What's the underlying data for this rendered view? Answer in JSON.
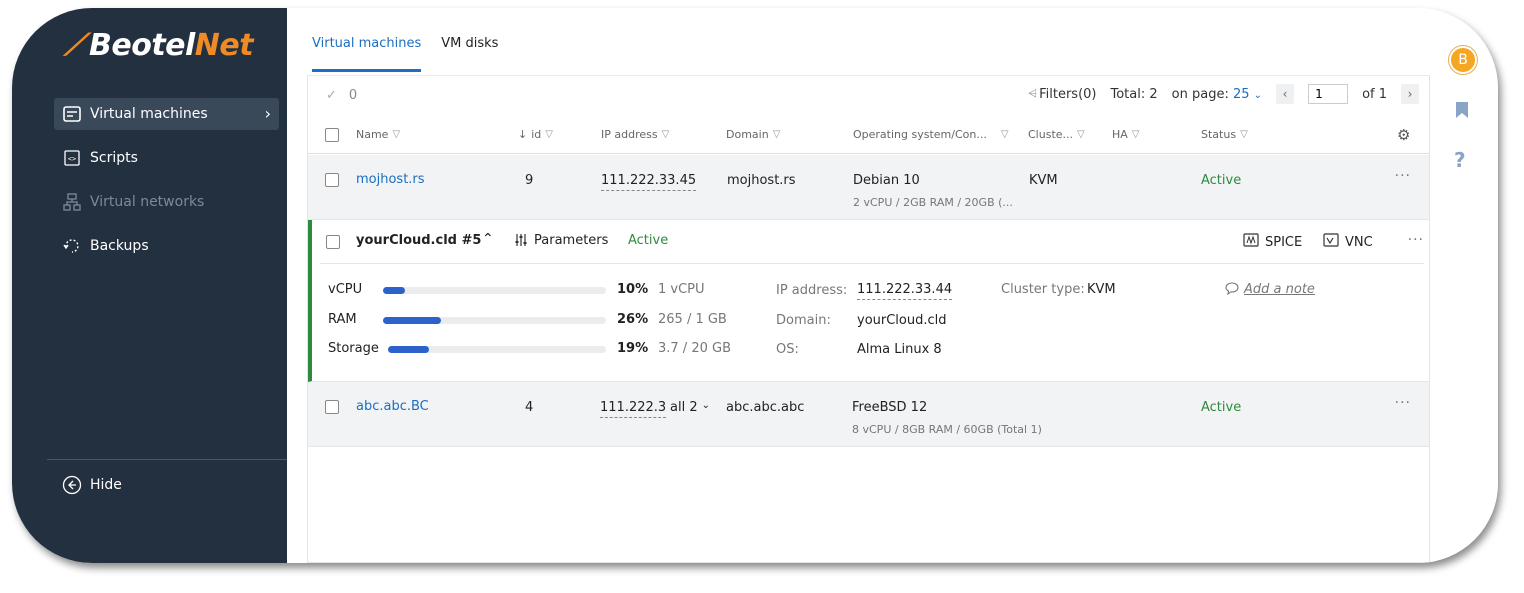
{
  "brand": {
    "name_white": "Beotel",
    "name_orange": "Net"
  },
  "sidebar": {
    "items": [
      {
        "label": "Virtual machines",
        "icon": "vm-icon",
        "active": true
      },
      {
        "label": "Scripts",
        "icon": "script-icon"
      },
      {
        "label": "Virtual networks",
        "icon": "network-icon",
        "disabled": true
      },
      {
        "label": "Backups",
        "icon": "backup-icon"
      }
    ],
    "hide_label": "Hide"
  },
  "tabs": [
    {
      "label": "Virtual machines",
      "active": true
    },
    {
      "label": "VM disks"
    }
  ],
  "toolbar": {
    "selected_count": "0",
    "filters_label": "Filters(0)",
    "total_label": "Total: 2",
    "on_page_label": "on page:",
    "on_page_value": "25",
    "page_value": "1",
    "of_label": "of 1"
  },
  "columns": {
    "name": "Name",
    "id": "id",
    "ip": "IP address",
    "domain": "Domain",
    "os": "Operating system/Con...",
    "cluster": "Cluste...",
    "ha": "HA",
    "status": "Status"
  },
  "rows": [
    {
      "name": "mojhost.rs",
      "id": "9",
      "ip": "111.222.33.45",
      "domain": "mojhost.rs",
      "os": "Debian 10",
      "config": "2 vCPU / 2GB RAM / 20GB (...",
      "cluster": "KVM",
      "status": "Active"
    },
    {
      "name": "abc.abc.BC",
      "id": "4",
      "ip": "111.222.3",
      "ip_more": "all 2",
      "domain": "abc.abc.abc",
      "os": "FreeBSD 12",
      "config": "8 vCPU / 8GB RAM / 60GB (Total 1)",
      "status": "Active"
    }
  ],
  "expanded": {
    "title": "yourCloud.cld #5",
    "parameters_label": "Parameters",
    "status": "Active",
    "spice_label": "SPICE",
    "vnc_label": "VNC",
    "resources": [
      {
        "label": "vCPU",
        "percent_text": "10%",
        "percent": 0.1,
        "detail": "1 vCPU"
      },
      {
        "label": "RAM",
        "percent_text": "26%",
        "percent": 0.26,
        "detail": "265 / 1 GB"
      },
      {
        "label": "Storage",
        "percent_text": "19%",
        "percent": 0.19,
        "detail": "3.7 / 20 GB"
      }
    ],
    "ip_label": "IP address:",
    "ip_value": "111.222.33.44",
    "domain_label": "Domain:",
    "domain_value": "yourCloud.cld",
    "os_label": "OS:",
    "os_value": "Alma Linux 8",
    "cluster_label": "Cluster type:",
    "cluster_value": "KVM",
    "note_label": "Add a note"
  },
  "rail": {
    "avatar_letter": "B"
  },
  "colors": {
    "sidebar_bg": "#23303f",
    "accent": "#1b6ec2",
    "active_status": "#2e8b3e",
    "brand_orange": "#f08a24",
    "bar": "#2c62c9"
  }
}
